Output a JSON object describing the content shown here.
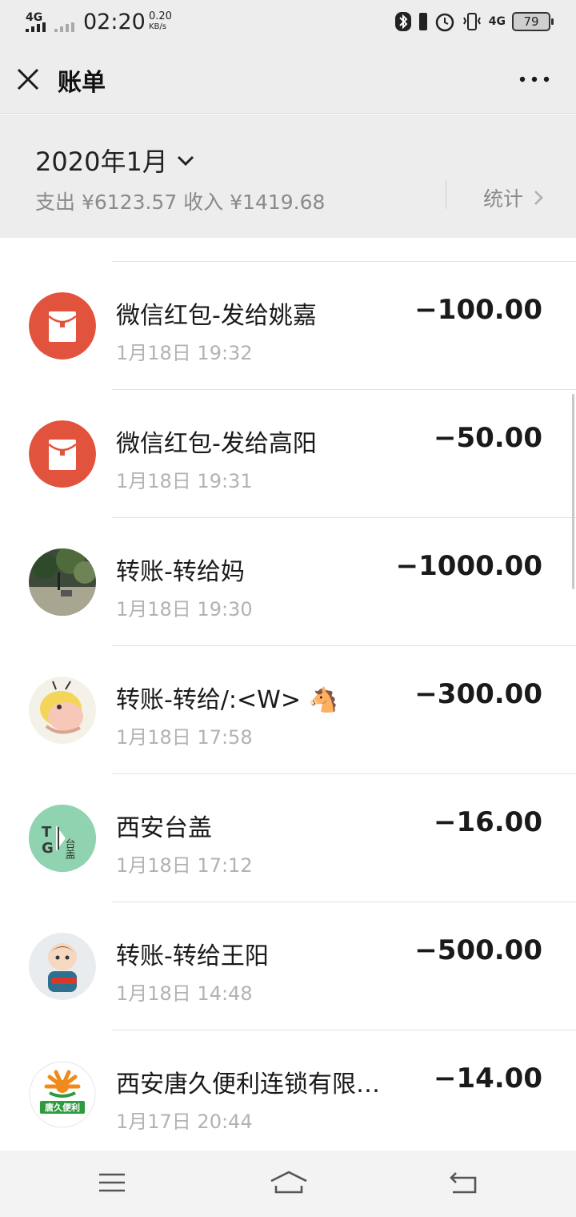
{
  "status_bar": {
    "network1": "4G",
    "network2": "4G",
    "time": "02:20",
    "speed_value": "0.20",
    "speed_unit": "KB/s",
    "battery": "79"
  },
  "header": {
    "title": "账单",
    "close_icon": "close-icon",
    "more_icon": "more-icon"
  },
  "summary": {
    "month": "2020年1月",
    "totals": "支出 ¥6123.57 收入 ¥1419.68",
    "stats_label": "统计"
  },
  "transactions": [
    {
      "name": "微信红包-发给姚嘉",
      "time": "1月18日 19:32",
      "amount": "−100.00",
      "avatar": "red-packet-icon"
    },
    {
      "name": "微信红包-发给高阳",
      "time": "1月18日 19:31",
      "amount": "−50.00",
      "avatar": "red-packet-icon"
    },
    {
      "name": "转账-转给妈",
      "time": "1月18日 19:30",
      "amount": "−1000.00",
      "avatar": "photo-avatar"
    },
    {
      "name": "转账-转给/:<W> 🐴",
      "time": "1月18日 17:58",
      "amount": "−300.00",
      "avatar": "cartoon-avatar"
    },
    {
      "name": "西安台盖",
      "time": "1月18日 17:12",
      "amount": "−16.00",
      "avatar": "taigai-logo"
    },
    {
      "name": "转账-转给王阳",
      "time": "1月18日 14:48",
      "amount": "−500.00",
      "avatar": "boy-avatar"
    },
    {
      "name": "西安唐久便利连锁有限…",
      "time": "1月17日 20:44",
      "amount": "−14.00",
      "avatar": "tangjiu-logo"
    }
  ],
  "logos": {
    "taigai_t": "T",
    "taigai_g": "G",
    "taigai_cn": "台盖",
    "tangjiu_cn": "唐久便利"
  },
  "colors": {
    "red_packet": "#e2533d",
    "taigai_bg": "#8fd3b0",
    "background": "#ededed"
  }
}
